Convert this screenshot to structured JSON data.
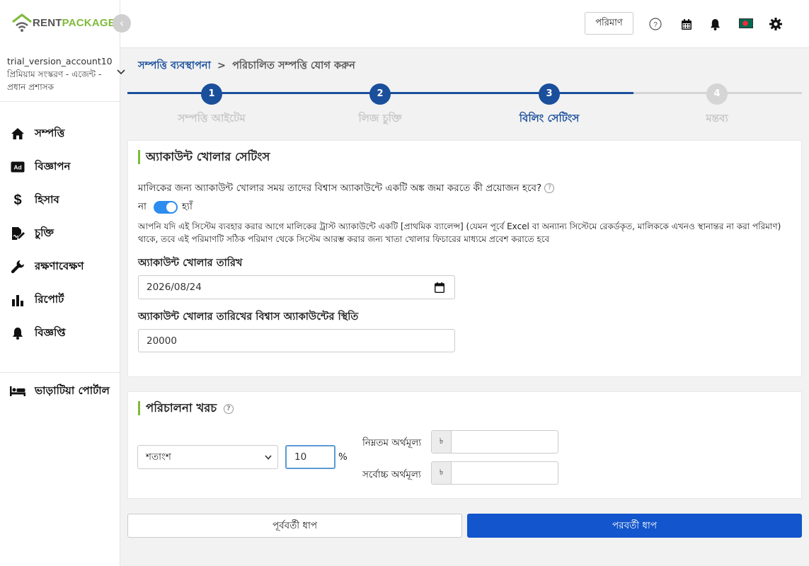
{
  "brand": {
    "rent": "RENT",
    "package": "PACKAGE"
  },
  "account": {
    "name": "trial_version_account10",
    "role": "প্রিমিয়াম সংস্করণ - এজেন্ট - প্রধান প্রশাসক"
  },
  "sidebar": {
    "items": [
      {
        "label": "সম্পত্তি",
        "icon": "home-icon"
      },
      {
        "label": "বিজ্ঞাপন",
        "icon": "ad-icon"
      },
      {
        "label": "হিসাব",
        "icon": "dollar-icon"
      },
      {
        "label": "চুক্তি",
        "icon": "contract-icon"
      },
      {
        "label": "রক্ষণাবেক্ষণ",
        "icon": "wrench-icon"
      },
      {
        "label": "রিপোর্ট",
        "icon": "bar-chart-icon"
      },
      {
        "label": "বিজ্ঞপ্তি",
        "icon": "bell-icon"
      }
    ],
    "tenant_portal": {
      "label": "ভাড়াটিয়া পোর্টাল",
      "icon": "bed-icon"
    }
  },
  "topbar": {
    "quantity_label": "পরিমাণ"
  },
  "breadcrumb": {
    "parent": "সম্পত্তি ব্যবস্থাপনা",
    "separator": ">",
    "current": "পরিচালিত সম্পত্তি যোগ করুন"
  },
  "steps": [
    {
      "number": "1",
      "label": "সম্পত্তি আইটেম",
      "state": "done"
    },
    {
      "number": "2",
      "label": "লিজ চুক্তি",
      "state": "done"
    },
    {
      "number": "3",
      "label": "বিলিং সেটিংস",
      "state": "active"
    },
    {
      "number": "4",
      "label": "মন্তব্য",
      "state": "pending"
    }
  ],
  "account_opening": {
    "title": "অ্যাকাউন্ট খোলার সেটিংস",
    "question": "মালিকের জন্য অ্যাকাউন্ট খোলার সময় তাদের বিশ্বাস অ্যাকাউন্টে একটি অঙ্ক জমা করতে কী প্রয়োজন হবে?",
    "toggle_no": "না",
    "toggle_yes": "হ্যাঁ",
    "toggle_on": true,
    "description": "আপনি যদি এই সিস্টেম ব্যবহার করার আগে মালিকের ট্রাস্ট অ্যাকাউন্টে একটি [প্রাথমিক ব্যালেন্স] (যেমন পূর্বে Excel বা অন্যান্য সিস্টেমে রেকর্ডকৃত, মালিককে এখনও স্থানান্তর না করা পরিমাণ) থাকে, তবে এই পরিমাণটি সঠিক পরিমাণ থেকে সিস্টেম আরম্ভ করার জন্য খাতা খোলার ফিচারের মাধ্যমে প্রবেশ করাতে হবে",
    "date_label": "অ্যাকাউন্ট খোলার তারিখ",
    "date_value": "2026/08/24",
    "balance_label": "অ্যাকাউন্ট খোলার তারিখের বিশ্বাস অ্যাকাউন্টের স্থিতি",
    "balance_value": "20000"
  },
  "management_fee": {
    "title": "পরিচালনা খরচ",
    "type_selected": "শতাংশ",
    "percent_value": "10",
    "percent_unit": "%",
    "min_label": "নিম্নতম অর্থমূল্য",
    "max_label": "সর্বোচ্চ অর্থমূল্য",
    "currency_symbol": "৳",
    "min_value": "",
    "max_value": ""
  },
  "buttons": {
    "prev": "পূর্ববর্তী ধাপ",
    "next": "পরবর্তী ধাপ"
  },
  "colors": {
    "primary": "#1255cc",
    "step_done": "#1a4f9c",
    "step_pending": "#d5d5d5",
    "brand_green": "#7fba3a",
    "toggle": "#2d8cf0"
  }
}
